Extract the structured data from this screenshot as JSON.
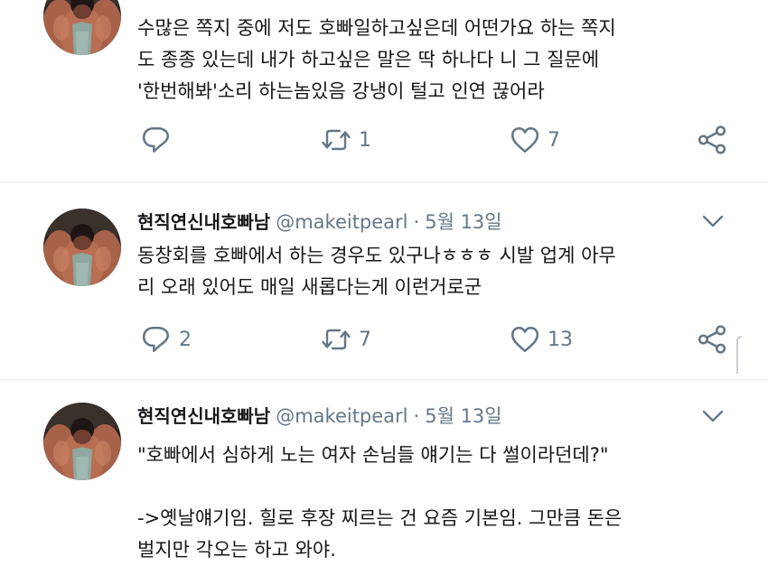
{
  "tweets": [
    {
      "text": "수많은 쪽지 중에 저도 호빠일하고싶은데 어떤가요 하는 쪽지\n도 종종 있는데 내가 하고싶은 말은 딱 하나다 니 그 질문에\n'한번해봐'소리 하는놈있음 강냉이 털고 인연 끊어라",
      "replies": "",
      "retweets": "1",
      "likes": "7"
    },
    {
      "display_name": "현직연신내호빠남",
      "handle": "@makeitpearl",
      "separator": "·",
      "date": "5월 13일",
      "text": "동창회를 호빠에서 하는 경우도 있구나ㅎㅎㅎ 시발 업계 아무\n리 오래 있어도 매일 새롭다는게 이런거로군",
      "replies": "2",
      "retweets": "7",
      "likes": "13"
    },
    {
      "display_name": "현직연신내호빠남",
      "handle": "@makeitpearl",
      "separator": "·",
      "date": "5월 13일",
      "text": "\"호빠에서 심하게 노는 여자 손님들 얘기는 다 썰이라던데?\"\n\n->옛날얘기임. 힐로 후장 찌르는 건 요즘 기본임. 그만큼 돈은\n벌지만 각오는 하고 와야."
    }
  ],
  "icons": {
    "reply": "reply-icon",
    "retweet": "retweet-icon",
    "like": "heart-icon",
    "share": "share-icon",
    "menu": "chevron-down-icon",
    "avatar": "avatar-photo"
  },
  "colors": {
    "icon": "#657786",
    "text": "#14171a",
    "secondary": "#657786",
    "divider": "#e6ecf0"
  }
}
